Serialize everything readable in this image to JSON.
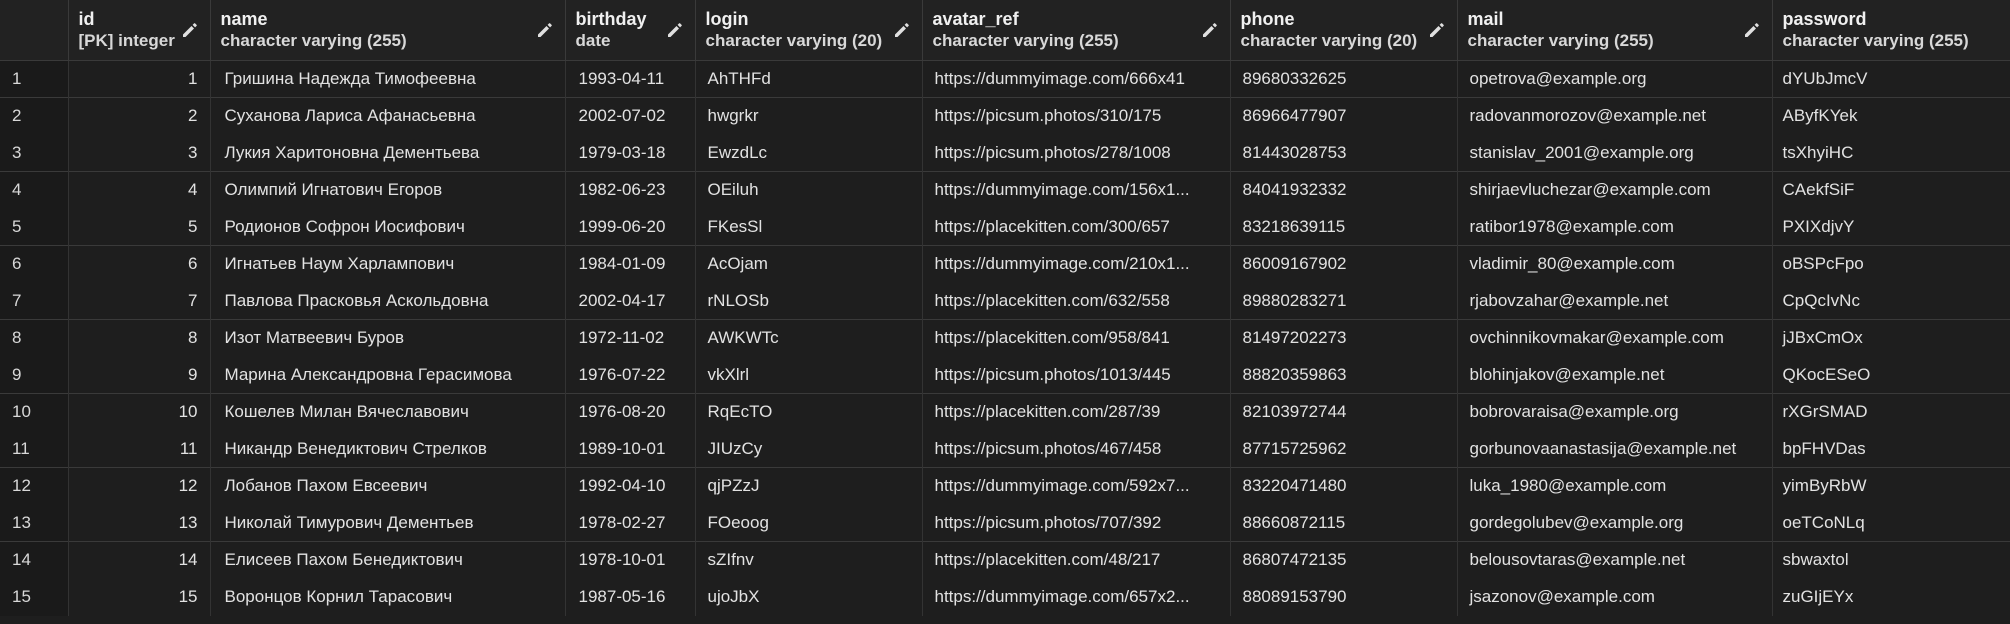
{
  "columns": [
    {
      "name": "id",
      "type": "[PK] integer"
    },
    {
      "name": "name",
      "type": "character varying (255)"
    },
    {
      "name": "birthday",
      "type": "date"
    },
    {
      "name": "login",
      "type": "character varying (20)"
    },
    {
      "name": "avatar_ref",
      "type": "character varying (255)"
    },
    {
      "name": "phone",
      "type": "character varying (20)"
    },
    {
      "name": "mail",
      "type": "character varying (255)"
    },
    {
      "name": "password",
      "type": "character varying (255)"
    }
  ],
  "rows": [
    {
      "rownum": "1",
      "id": "1",
      "name": "Гришина Надежда Тимофеевна",
      "birthday": "1993-04-11",
      "login": "AhTHFd",
      "avatar_ref": "https://dummyimage.com/666x41",
      "phone": "89680332625",
      "mail": "opetrova@example.org",
      "password": "dYUbJmcV"
    },
    {
      "rownum": "2",
      "id": "2",
      "name": "Суханова Лариса Афанасьевна",
      "birthday": "2002-07-02",
      "login": "hwgrkr",
      "avatar_ref": "https://picsum.photos/310/175",
      "phone": "86966477907",
      "mail": "radovanmorozov@example.net",
      "password": "AByfKYek"
    },
    {
      "rownum": "3",
      "id": "3",
      "name": "Лукия Харитоновна Дементьева",
      "birthday": "1979-03-18",
      "login": "EwzdLc",
      "avatar_ref": "https://picsum.photos/278/1008",
      "phone": "81443028753",
      "mail": "stanislav_2001@example.org",
      "password": "tsXhyiHC"
    },
    {
      "rownum": "4",
      "id": "4",
      "name": "Олимпий Игнатович Егоров",
      "birthday": "1982-06-23",
      "login": "OEiluh",
      "avatar_ref": "https://dummyimage.com/156x1...",
      "phone": "84041932332",
      "mail": "shirjaevluchezar@example.com",
      "password": "CAekfSiF"
    },
    {
      "rownum": "5",
      "id": "5",
      "name": "Родионов Софрон Иосифович",
      "birthday": "1999-06-20",
      "login": "FKesSl",
      "avatar_ref": "https://placekitten.com/300/657",
      "phone": "83218639115",
      "mail": "ratibor1978@example.com",
      "password": "PXIXdjvY"
    },
    {
      "rownum": "6",
      "id": "6",
      "name": "Игнатьев Наум Харлампович",
      "birthday": "1984-01-09",
      "login": "AcOjam",
      "avatar_ref": "https://dummyimage.com/210x1...",
      "phone": "86009167902",
      "mail": "vladimir_80@example.com",
      "password": "oBSPcFpo"
    },
    {
      "rownum": "7",
      "id": "7",
      "name": "Павлова Прасковья Аскольдовна",
      "birthday": "2002-04-17",
      "login": "rNLOSb",
      "avatar_ref": "https://placekitten.com/632/558",
      "phone": "89880283271",
      "mail": "rjabovzahar@example.net",
      "password": "CpQcIvNc"
    },
    {
      "rownum": "8",
      "id": "8",
      "name": "Изот Матвеевич Буров",
      "birthday": "1972-11-02",
      "login": "AWKWTc",
      "avatar_ref": "https://placekitten.com/958/841",
      "phone": "81497202273",
      "mail": "ovchinnikovmakar@example.com",
      "password": "jJBxCmOx"
    },
    {
      "rownum": "9",
      "id": "9",
      "name": "Марина Александровна Герасимова",
      "birthday": "1976-07-22",
      "login": "vkXlrl",
      "avatar_ref": "https://picsum.photos/1013/445",
      "phone": "88820359863",
      "mail": "blohinjakov@example.net",
      "password": "QKocESeO"
    },
    {
      "rownum": "10",
      "id": "10",
      "name": "Кошелев Милан Вячеславович",
      "birthday": "1976-08-20",
      "login": "RqEcTO",
      "avatar_ref": "https://placekitten.com/287/39",
      "phone": "82103972744",
      "mail": "bobrovaraisa@example.org",
      "password": "rXGrSMAD"
    },
    {
      "rownum": "11",
      "id": "11",
      "name": "Никандр Венедиктович Стрелков",
      "birthday": "1989-10-01",
      "login": "JIUzCy",
      "avatar_ref": "https://picsum.photos/467/458",
      "phone": "87715725962",
      "mail": "gorbunovaanastasija@example.net",
      "password": "bpFHVDas"
    },
    {
      "rownum": "12",
      "id": "12",
      "name": "Лобанов Пахом Евсеевич",
      "birthday": "1992-04-10",
      "login": "qjPZzJ",
      "avatar_ref": "https://dummyimage.com/592x7...",
      "phone": "83220471480",
      "mail": "luka_1980@example.com",
      "password": "yimByRbW"
    },
    {
      "rownum": "13",
      "id": "13",
      "name": "Николай Тимурович Дементьев",
      "birthday": "1978-02-27",
      "login": "FOeoog",
      "avatar_ref": "https://picsum.photos/707/392",
      "phone": "88660872115",
      "mail": "gordegolubev@example.org",
      "password": "oeTCoNLq"
    },
    {
      "rownum": "14",
      "id": "14",
      "name": "Елисеев Пахом Бенедиктович",
      "birthday": "1978-10-01",
      "login": "sZIfnv",
      "avatar_ref": "https://placekitten.com/48/217",
      "phone": "86807472135",
      "mail": "belousovtaras@example.net",
      "password": "sbwaxtol"
    },
    {
      "rownum": "15",
      "id": "15",
      "name": "Воронцов Корнил Тарасович",
      "birthday": "1987-05-16",
      "login": "ujoJbX",
      "avatar_ref": "https://dummyimage.com/657x2...",
      "phone": "88089153790",
      "mail": "jsazonov@example.com",
      "password": "zuGIjEYx"
    }
  ],
  "icons": {
    "edit": "pencil-icon"
  }
}
